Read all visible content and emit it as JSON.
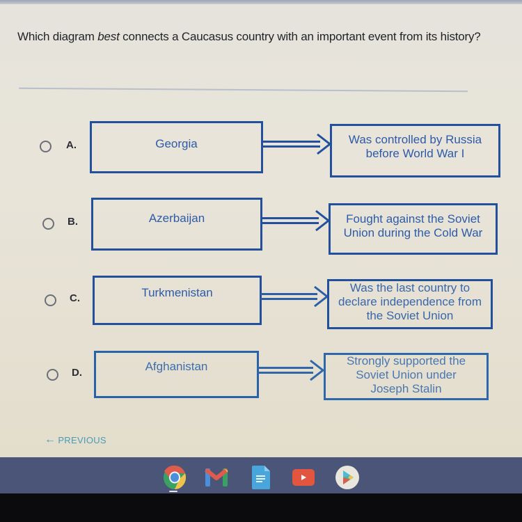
{
  "question": {
    "text_before": "Which diagram ",
    "emphasis": "best",
    "text_after": " connects a Caucasus country with an important event from its history?"
  },
  "options": [
    {
      "letter": "A.",
      "country": "Georgia",
      "event": "Was controlled by Russia before World War I",
      "selected": false
    },
    {
      "letter": "B.",
      "country": "Azerbaijan",
      "event": "Fought against the Soviet Union during the Cold War",
      "selected": false
    },
    {
      "letter": "C.",
      "country": "Turkmenistan",
      "event": "Was the last country to declare independence from the Soviet Union",
      "selected": false
    },
    {
      "letter": "D.",
      "country": "Afghanistan",
      "event": "Strongly supported the Soviet Union under Joseph Stalin",
      "selected": false
    }
  ],
  "navigation": {
    "previous_label": "PREVIOUS",
    "previous_icon": "arrow-left-icon"
  },
  "taskbar": {
    "apps": [
      {
        "name": "Chrome",
        "icon": "chrome-icon",
        "active": true
      },
      {
        "name": "Gmail",
        "icon": "gmail-icon",
        "active": false
      },
      {
        "name": "Docs",
        "icon": "docs-icon",
        "active": false
      },
      {
        "name": "YouTube",
        "icon": "youtube-icon",
        "active": false
      },
      {
        "name": "Play Store",
        "icon": "play-store-icon",
        "active": false
      }
    ]
  },
  "colors": {
    "diagram_border": "#22509c",
    "diagram_text": "#2d5ba8",
    "link": "#4b9bb3",
    "taskbar": "#4a5578"
  }
}
